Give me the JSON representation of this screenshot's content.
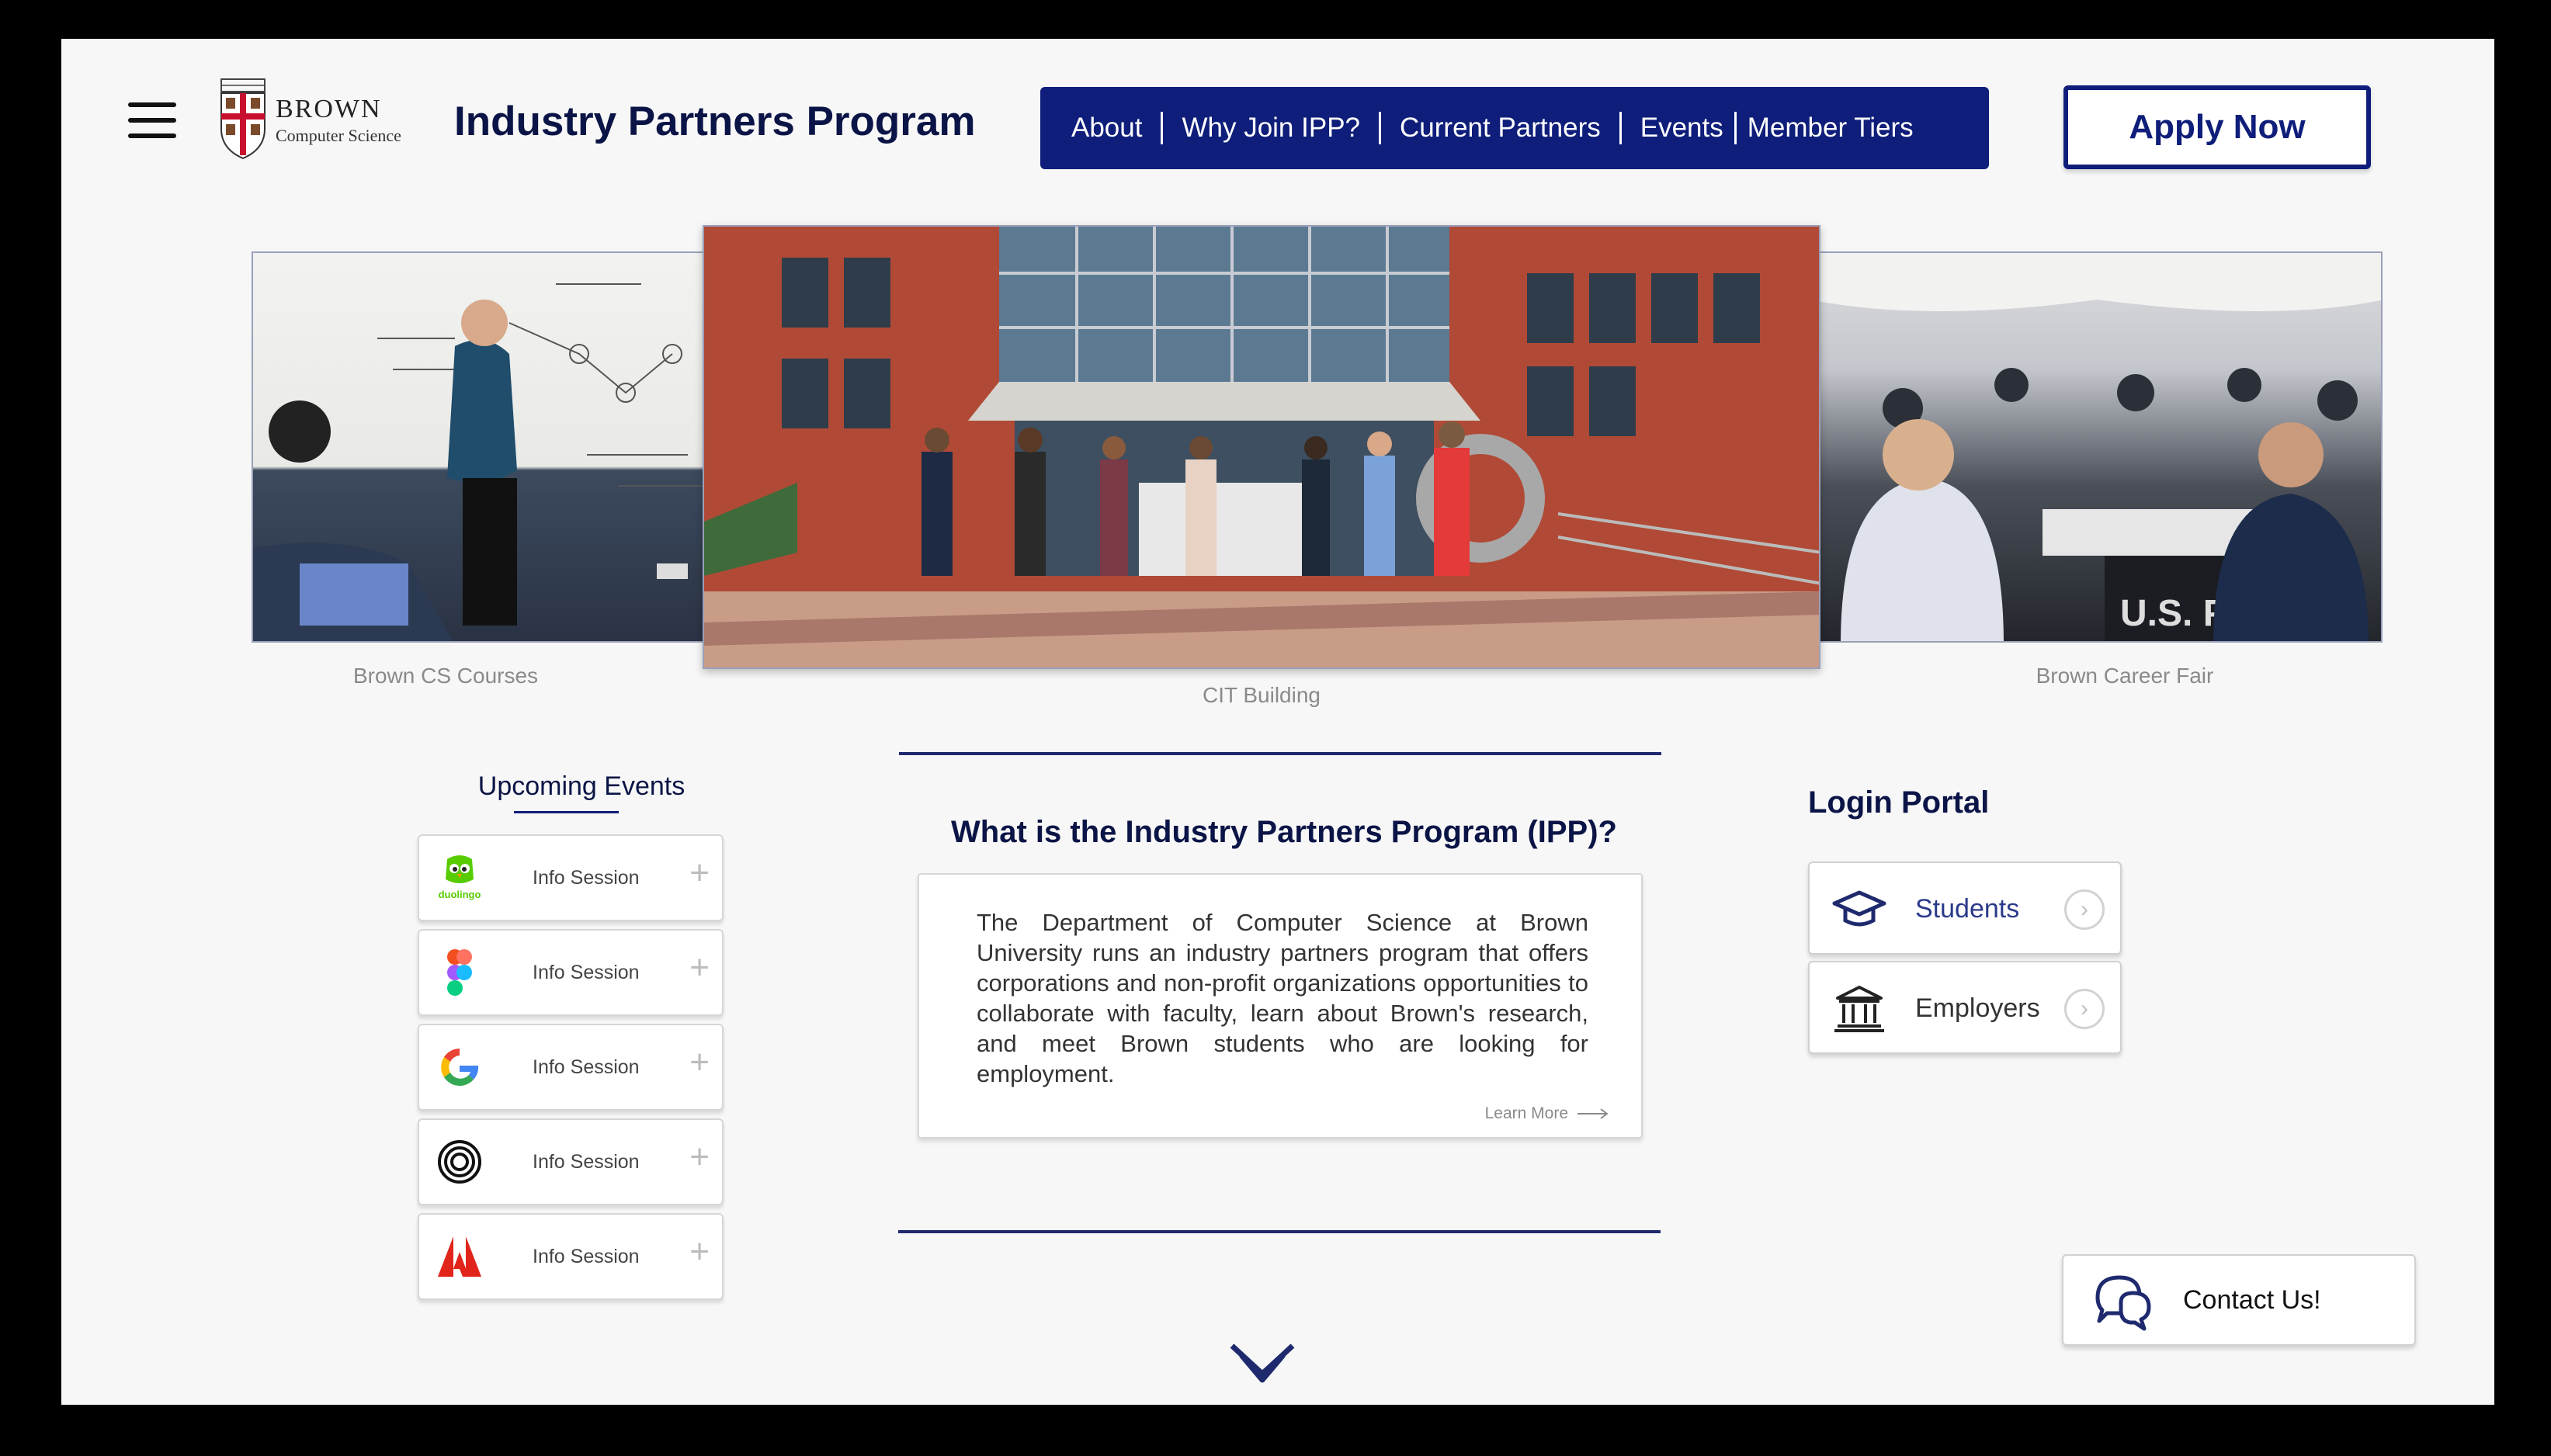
{
  "header": {
    "brand_name": "BROWN",
    "brand_sub": "Computer Science",
    "title": "Industry Partners Program"
  },
  "nav": {
    "items": [
      "About",
      "Why Join IPP?",
      "Current Partners",
      "Events",
      "Member Tiers"
    ]
  },
  "apply_label": "Apply Now",
  "photos": {
    "left_caption": "Brown CS Courses",
    "center_caption": "CIT Building",
    "right_caption": "Brown Career Fair"
  },
  "events": {
    "title": "Upcoming Events",
    "items": [
      {
        "logo": "duolingo-icon",
        "logo_text": "duolingo",
        "label": "Info Session"
      },
      {
        "logo": "figma-icon",
        "label": "Info Session"
      },
      {
        "logo": "google-icon",
        "label": "Info Session"
      },
      {
        "logo": "rings-logo-icon",
        "label": "Info Session"
      },
      {
        "logo": "adobe-icon",
        "label": "Info Session"
      }
    ]
  },
  "about": {
    "heading": "What is the Industry Partners Program (IPP)?",
    "body": "The Department of Computer Science at Brown University runs an industry partners program that offers corporations and non-profit organizations opportunities to collaborate with faculty, learn about Brown's research, and meet Brown students who are looking for employment.",
    "learn_more": "Learn More"
  },
  "login": {
    "title": "Login Portal",
    "items": [
      {
        "icon": "graduation-cap-icon",
        "label": "Students",
        "color": "#2a3a8a"
      },
      {
        "icon": "bank-icon",
        "label": "Employers",
        "color": "#333333"
      }
    ]
  },
  "contact_label": "Contact Us!",
  "colors": {
    "navy": "#0f1e7a",
    "title": "#0b1446",
    "background": "#f7f7f7"
  }
}
